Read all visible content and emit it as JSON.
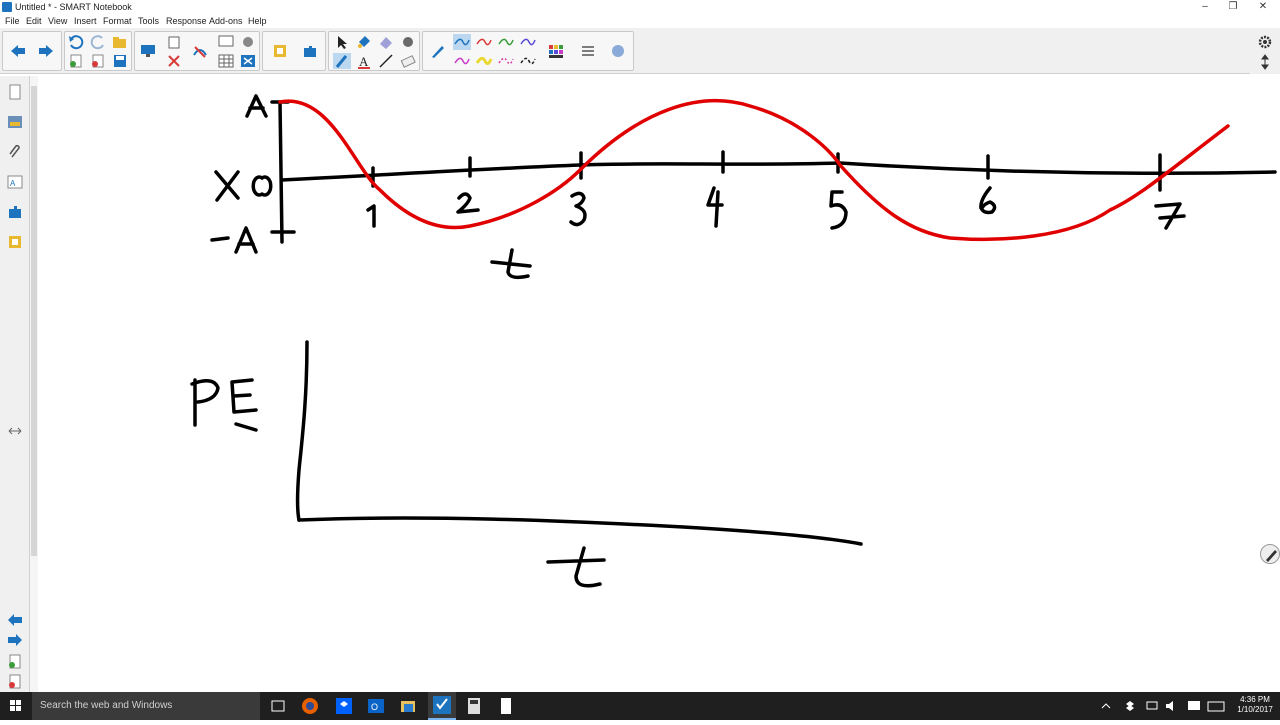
{
  "window": {
    "title": "Untitled * - SMART Notebook"
  },
  "menu": [
    "File",
    "Edit",
    "View",
    "Insert",
    "Format",
    "Tools",
    "Response",
    "Add-ons",
    "Help"
  ],
  "whiteboard": {
    "graph1": {
      "y_top_label": "A",
      "y_mid_label": "X 0",
      "y_bot_label": "-A",
      "ticks": [
        "1",
        "2",
        "3",
        "4",
        "5",
        "6",
        "7"
      ],
      "x_label": "t"
    },
    "graph2": {
      "y_label": "PE",
      "x_label": "t"
    }
  },
  "taskbar": {
    "search_placeholder": "Search the web and Windows",
    "time": "4:36 PM",
    "date": "1/10/2017"
  },
  "colors": {
    "ink": "#000000",
    "curve": "#e00000",
    "accent": "#1e73be",
    "taskbar": "#1f1f1f"
  }
}
